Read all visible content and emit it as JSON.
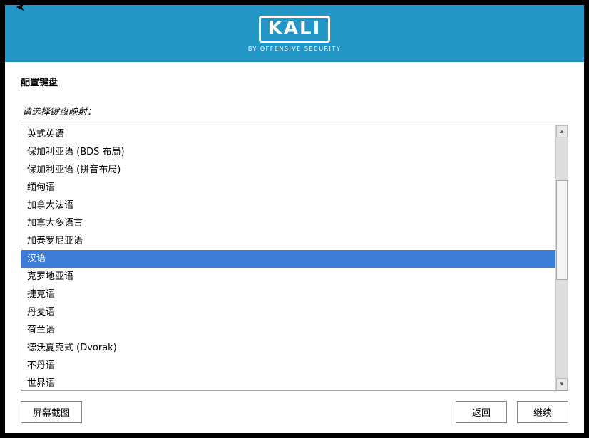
{
  "logo": {
    "text": "KALI",
    "subtext": "BY OFFENSIVE SECURITY"
  },
  "page_title": "配置键盘",
  "instruction": "请选择键盘映射：",
  "selected_index": 7,
  "keyboard_list": [
    "英式英语",
    "保加利亚语 (BDS 布局)",
    "保加利亚语 (拼音布局)",
    "缅甸语",
    "加拿大法语",
    "加拿大多语言",
    "加泰罗尼亚语",
    "汉语",
    "克罗地亚语",
    "捷克语",
    "丹麦语",
    "荷兰语",
    "德沃夏克式 (Dvorak)",
    "不丹语",
    "世界语"
  ],
  "buttons": {
    "screenshot": "屏幕截图",
    "back": "返回",
    "continue": "继续"
  }
}
